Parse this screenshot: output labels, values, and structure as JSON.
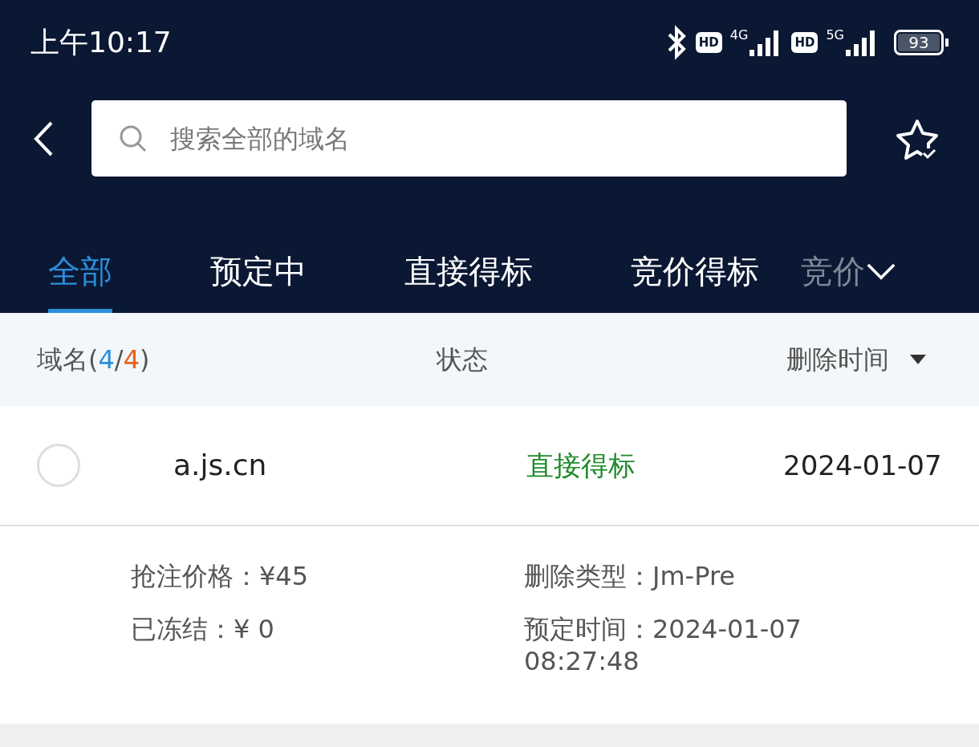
{
  "status_bar": {
    "time": "上午10:17",
    "battery": "93",
    "network_1": "4G",
    "network_2": "5G",
    "hd_1": "HD",
    "hd_2": "HD"
  },
  "search": {
    "placeholder": "搜索全部的域名"
  },
  "tabs": [
    {
      "label": "全部",
      "selected": true
    },
    {
      "label": "预定中",
      "selected": false
    },
    {
      "label": "直接得标",
      "selected": false
    },
    {
      "label": "竞价得标",
      "selected": false
    },
    {
      "label": "竞价",
      "selected": false
    }
  ],
  "table": {
    "header_parts": [
      {
        "text": "域名(",
        "color": "#555555"
      },
      {
        "text": "4",
        "color": "#2b8fdc"
      },
      {
        "text": "/",
        "color": "#555555"
      },
      {
        "text": "4",
        "color": "#e8601c"
      },
      {
        "text": ")",
        "color": "#555555"
      }
    ],
    "columns": [
      "状态",
      "删除时间"
    ],
    "rows": [
      {
        "domain": "a.js.cn",
        "checked": false,
        "status": "直接得标",
        "date": "2024-01-07",
        "details": [
          {
            "label": "抢注价格：",
            "value": "¥45"
          },
          {
            "label": "删除类型：",
            "value": "Jm-Pre"
          },
          {
            "label": "已冻结：",
            "value": "¥ 0"
          },
          {
            "label": "预定时间：",
            "value": "2024-01-07 08:27:48"
          }
        ]
      }
    ]
  }
}
